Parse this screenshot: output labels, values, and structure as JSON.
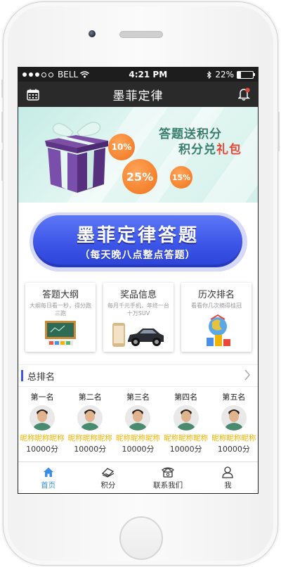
{
  "status": {
    "carrier": "BELL",
    "time": "4:21 PM",
    "battery": "22%",
    "battery_level": 0.22
  },
  "nav": {
    "title": "墨菲定律",
    "left_icon": "calendar-icon",
    "right_icon": "bell-icon"
  },
  "banner": {
    "line1": "答题送积分",
    "line2a": "积分兑",
    "line2b": "礼包",
    "bubble1": "10%",
    "bubble2": "25%",
    "bubble3": "15%"
  },
  "main_button": {
    "title": "墨菲定律答题",
    "subtitle": "（每天晚八点整点答题）"
  },
  "cards": [
    {
      "title": "答题大纲",
      "desc": "大纲每日看一秒，得分跑三跑"
    },
    {
      "title": "奖品信息",
      "desc": "每月千元手机，年终一台十万SUV"
    },
    {
      "title": "历次排名",
      "desc": "看看你几次摘得桂冠"
    }
  ],
  "ranking": {
    "title": "总排名",
    "items": [
      {
        "pos": "第一名",
        "nick": "昵称昵称昵称",
        "score": "10000分"
      },
      {
        "pos": "第二名",
        "nick": "昵称昵称昵称",
        "score": "10000分"
      },
      {
        "pos": "第三名",
        "nick": "昵称昵称昵称",
        "score": "10000分"
      },
      {
        "pos": "第四名",
        "nick": "昵称昵称昵称",
        "score": "10000分"
      },
      {
        "pos": "第五名",
        "nick": "昵称昵称昵称",
        "score": "10000分"
      }
    ]
  },
  "tabs": [
    {
      "label": "首页",
      "icon": "home-icon"
    },
    {
      "label": "积分",
      "icon": "points-icon"
    },
    {
      "label": "联系我们",
      "icon": "phone-icon"
    },
    {
      "label": "我",
      "icon": "user-icon"
    }
  ],
  "colors": {
    "accent": "#3d56e8",
    "active_tab": "#3a8fe0",
    "nick": "#f0b400",
    "bubble": "#f0721a"
  }
}
